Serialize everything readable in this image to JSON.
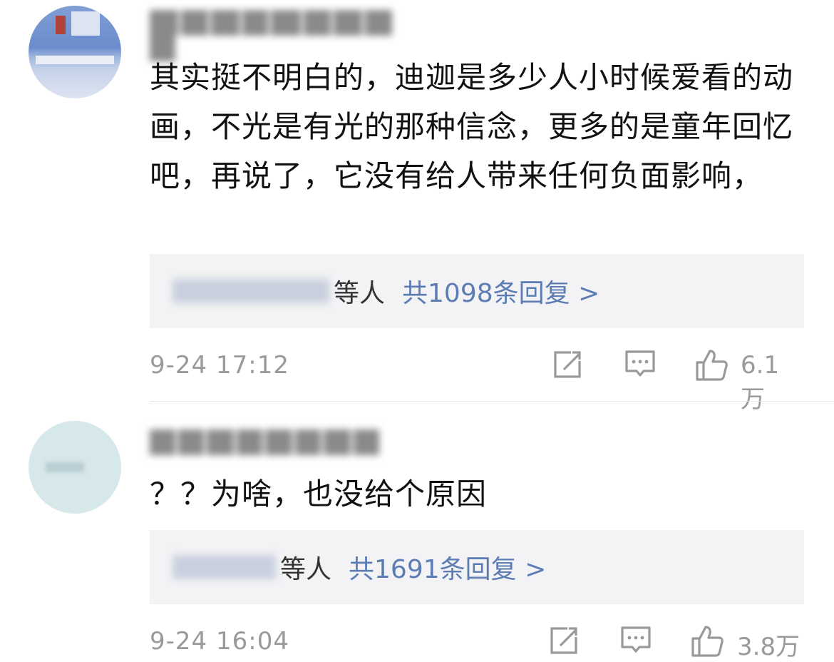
{
  "comments": [
    {
      "username": "",
      "text": "其实挺不明白的，迪迦是多少人小时候爱看的动画，不光是有光的那种信念，更多的是童年回忆吧，再说了，它没有给人带来任何负面影响，",
      "replies": {
        "names": "",
        "etc": "等人",
        "link": "共1098条回复 >"
      },
      "time": "9-24 17:12",
      "likes": "6.1万",
      "icons": [
        "share-icon",
        "comment-icon",
        "like-icon"
      ]
    },
    {
      "username": "",
      "text": "？？为啥，也没给个原因",
      "replies": {
        "names": "",
        "etc": "等人",
        "link": "共1691条回复 >"
      },
      "time": "9-24 16:04",
      "likes": "3.8万",
      "icons": [
        "share-icon",
        "comment-icon",
        "like-icon"
      ]
    }
  ],
  "colors": {
    "text": "#111111",
    "meta": "#9a9a9a",
    "link": "#5b7db4",
    "reply_bg": "#f3f3f5",
    "divider": "#e6e6e6"
  }
}
